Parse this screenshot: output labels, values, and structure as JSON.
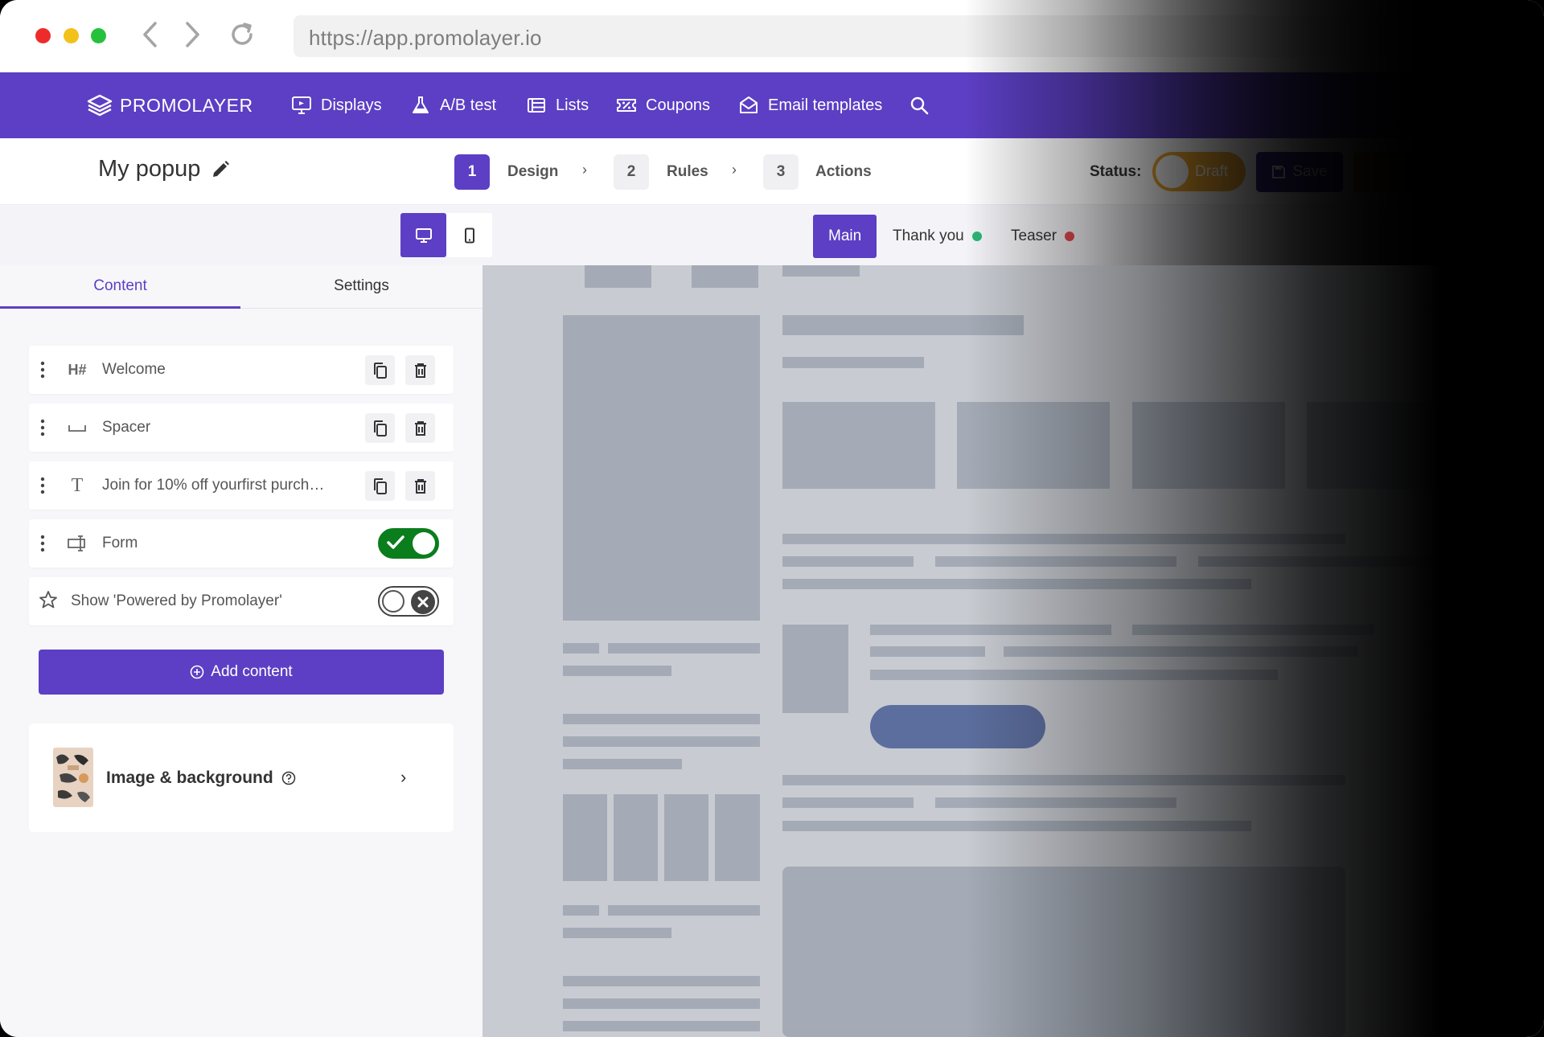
{
  "browser": {
    "url": "https://app.promolayer.io"
  },
  "nav": {
    "brand": "PROMOLAYER",
    "items": [
      {
        "label": "Displays",
        "icon": "monitor-icon"
      },
      {
        "label": "A/B test",
        "icon": "flask-icon"
      },
      {
        "label": "Lists",
        "icon": "list-icon"
      },
      {
        "label": "Coupons",
        "icon": "coupon-icon"
      },
      {
        "label": "Email templates",
        "icon": "envelope-icon"
      }
    ]
  },
  "editor": {
    "title": "My popup",
    "steps": [
      {
        "num": "1",
        "label": "Design"
      },
      {
        "num": "2",
        "label": "Rules"
      },
      {
        "num": "3",
        "label": "Actions"
      }
    ],
    "status_label": "Status:",
    "status_value": "Draft",
    "save_label": "Save"
  },
  "view_tabs": [
    {
      "label": "Main",
      "active": true
    },
    {
      "label": "Thank you",
      "dot_color": "#2bb673"
    },
    {
      "label": "Teaser",
      "dot_color": "#e5484d"
    }
  ],
  "sidebar": {
    "tabs": [
      "Content",
      "Settings"
    ],
    "blocks": [
      {
        "label": "Welcome",
        "kind_icon": "heading-icon"
      },
      {
        "label": "Spacer",
        "kind_icon": "spacer-icon"
      },
      {
        "label": "Join for 10% off yourfirst purch…",
        "kind_icon": "text-icon"
      },
      {
        "label": "Form",
        "kind_icon": "form-icon",
        "enabled": true
      }
    ],
    "powered_by": {
      "label": "Show 'Powered by Promolayer'",
      "enabled": false
    },
    "add_content": "Add content",
    "image_bg": "Image & background"
  },
  "colors": {
    "brand": "#5c3fc4",
    "toggle_on": "#0a7d1c",
    "status_draft": "#f0a82e"
  }
}
